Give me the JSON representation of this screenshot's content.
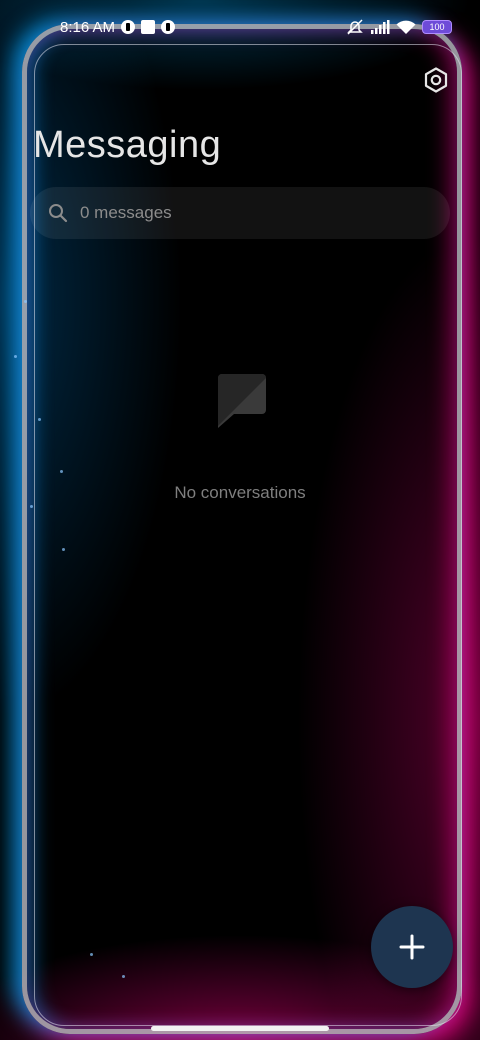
{
  "status_bar": {
    "time": "8:16 AM",
    "battery": "100",
    "icons": [
      "notification-app-icon",
      "notification-square-icon",
      "notification-app-icon",
      "mute-icon",
      "signal-icon",
      "wifi-icon",
      "battery-icon"
    ]
  },
  "header": {
    "title": "Messaging",
    "settings_icon": "gear-icon"
  },
  "search": {
    "placeholder": "0 messages",
    "value": "",
    "icon": "search-icon"
  },
  "empty_state": {
    "icon": "message-bubble-icon",
    "text": "No conversations"
  },
  "fab": {
    "icon": "plus-icon"
  },
  "colors": {
    "neon_blue": "#00aaff",
    "neon_pink": "#ff008c",
    "fab_background": "#1e3550",
    "muted_text": "#7f7f7f"
  }
}
